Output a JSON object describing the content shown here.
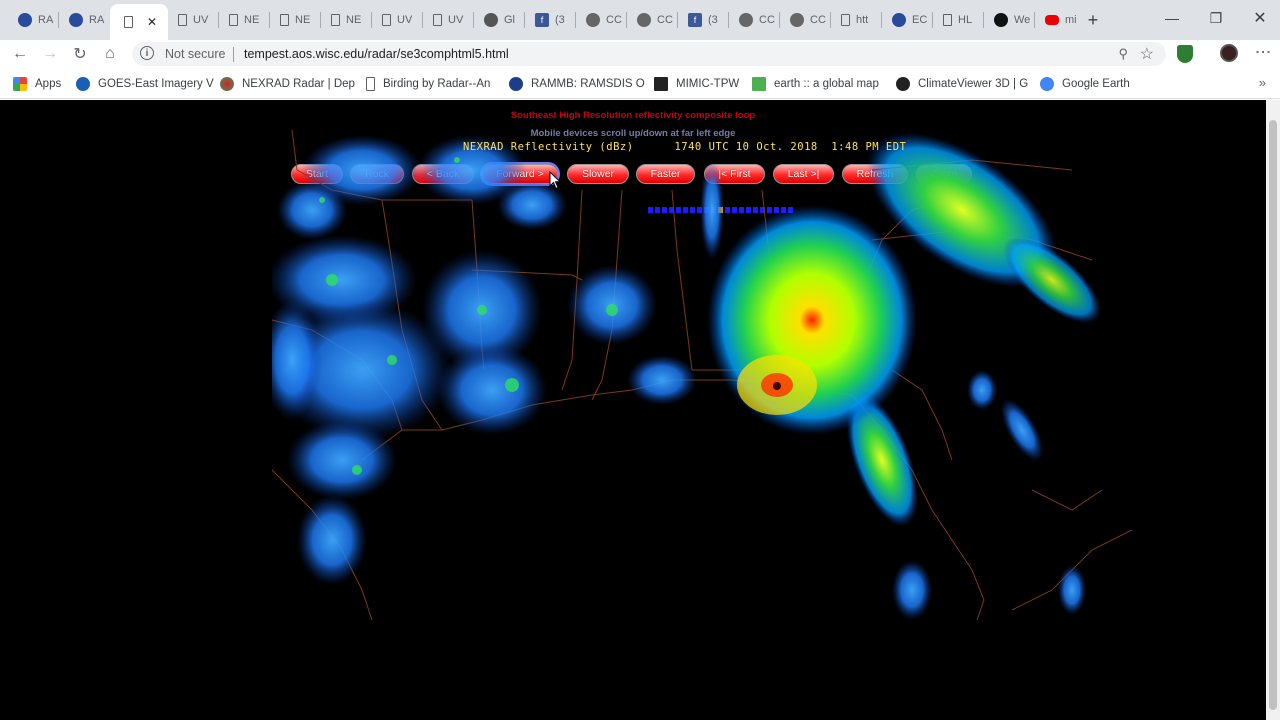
{
  "tabs": [
    {
      "label": "RA",
      "icon": "globe-blue-icon",
      "active": false
    },
    {
      "label": "RA",
      "icon": "globe-blue-icon",
      "active": false
    },
    {
      "label": "",
      "icon": "page-icon",
      "active": true
    },
    {
      "label": "UV",
      "icon": "page-icon",
      "active": false
    },
    {
      "label": "NE",
      "icon": "page-icon",
      "active": false
    },
    {
      "label": "NE",
      "icon": "page-icon",
      "active": false
    },
    {
      "label": "NE",
      "icon": "page-icon",
      "active": false
    },
    {
      "label": "UV",
      "icon": "page-icon",
      "active": false
    },
    {
      "label": "UV",
      "icon": "page-icon",
      "active": false
    },
    {
      "label": "Gl",
      "icon": "photo-icon",
      "active": false
    },
    {
      "label": "(3",
      "icon": "facebook-icon",
      "active": false
    },
    {
      "label": "CC",
      "icon": "globe-gray-icon",
      "active": false
    },
    {
      "label": "CC",
      "icon": "globe-gray-icon",
      "active": false
    },
    {
      "label": "(3",
      "icon": "facebook-icon",
      "active": false
    },
    {
      "label": "CC",
      "icon": "globe-gray-icon",
      "active": false
    },
    {
      "label": "CC",
      "icon": "globe-gray-icon",
      "active": false
    },
    {
      "label": "htt",
      "icon": "page-icon",
      "active": false
    },
    {
      "label": "EC",
      "icon": "globe-blue-icon",
      "active": false
    },
    {
      "label": "HL",
      "icon": "page-icon",
      "active": false
    },
    {
      "label": "We",
      "icon": "waves-icon",
      "active": false
    },
    {
      "label": "mi",
      "icon": "youtube-icon",
      "active": false
    }
  ],
  "address": {
    "security": "Not secure",
    "url": "tempest.aos.wisc.edu/radar/se3comphtml5.html"
  },
  "bookmarks": [
    {
      "label": "Apps"
    },
    {
      "label": "GOES-East Imagery V"
    },
    {
      "label": "NEXRAD Radar | Dep"
    },
    {
      "label": "Birding by Radar--An"
    },
    {
      "label": "RAMMB: RAMSDIS O"
    },
    {
      "label": "MIMIC-TPW"
    },
    {
      "label": "earth :: a global map"
    },
    {
      "label": "ClimateViewer 3D | G"
    },
    {
      "label": "Google Earth"
    }
  ],
  "page": {
    "heading": "Southeast High Resolution reflectivity composite loop",
    "subheading": "Mobile devices scroll up/down at far left edge",
    "controls": [
      "Start",
      "Rock",
      "< Back",
      "Forward >",
      "Slower",
      "Faster",
      "|< First",
      "Last >|",
      "Refresh",
      "Zoom"
    ],
    "frame_count": 21,
    "current_frame": 10,
    "map_title": "NEXRAD Reflectivity (dBz)      1740 UTC 10 Oct. 2018  1:48 PM EDT"
  },
  "colors": {
    "control_red": "#ff2a2a",
    "heading_red": "#c4000f",
    "frame_blue": "#1c1cff",
    "frame_current": "#ffa500",
    "map_title": "#ffe060"
  }
}
